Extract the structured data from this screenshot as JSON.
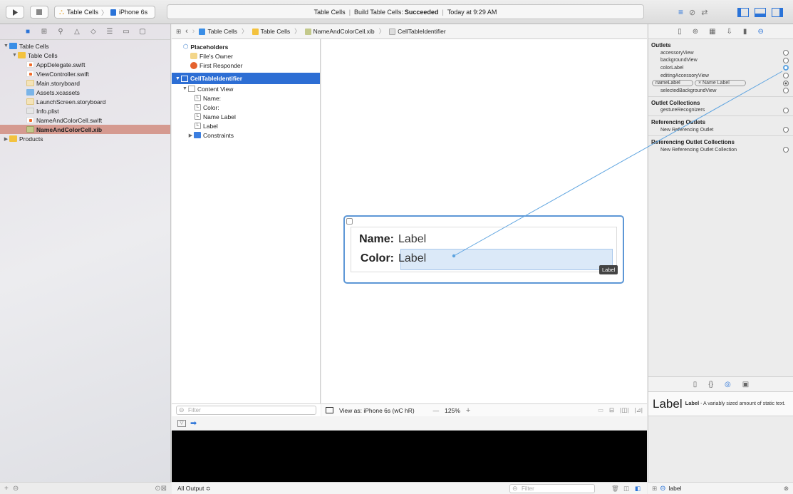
{
  "toolbar": {
    "run_icon": "play-icon",
    "stop_icon": "stop-icon",
    "scheme": {
      "app": "Table Cells",
      "device": "iPhone 6s"
    },
    "activity": {
      "project": "Table Cells",
      "build_prefix": "Build Table Cells:",
      "build_status": "Succeeded",
      "time": "Today at 9:29 AM"
    }
  },
  "navigator": {
    "tabs": [
      "folder-icon",
      "symbol-icon",
      "search-icon",
      "warning-icon",
      "test-icon",
      "debug-icon",
      "breakpoint-icon",
      "report-icon"
    ],
    "items": [
      {
        "label": "Table Cells",
        "icon": "proj",
        "level": 0,
        "disclosure": "▼"
      },
      {
        "label": "Table Cells",
        "icon": "folder",
        "level": 1,
        "disclosure": "▼"
      },
      {
        "label": "AppDelegate.swift",
        "icon": "swift",
        "level": 2
      },
      {
        "label": "ViewController.swift",
        "icon": "swift",
        "level": 2
      },
      {
        "label": "Main.storyboard",
        "icon": "sb",
        "level": 2
      },
      {
        "label": "Assets.xcassets",
        "icon": "xcassets",
        "level": 2
      },
      {
        "label": "LaunchScreen.storyboard",
        "icon": "sb",
        "level": 2
      },
      {
        "label": "Info.plist",
        "icon": "plist",
        "level": 2
      },
      {
        "label": "NameAndColorCell.swift",
        "icon": "swift",
        "level": 2
      },
      {
        "label": "NameAndColorCell.xib",
        "icon": "xib",
        "level": 2,
        "selected": true
      },
      {
        "label": "Products",
        "icon": "folder",
        "level": 0,
        "disclosure": "▶"
      }
    ]
  },
  "jumpbar": {
    "crumbs": [
      "Table Cells",
      "Table Cells",
      "NameAndColorCell.xib",
      "CellTableIdentifier"
    ]
  },
  "outline": {
    "placeholders": "Placeholders",
    "files_owner": "File's Owner",
    "first_responder": "First Responder",
    "cell": "CellTableIdentifier",
    "content_view": "Content View",
    "labels": [
      "Name:",
      "Color:",
      "Name Label",
      "Label"
    ],
    "constraints": "Constraints",
    "filter_placeholder": "Filter"
  },
  "canvas": {
    "name_key": "Name:",
    "name_val": "Label",
    "color_key": "Color:",
    "color_val": "Label",
    "tag": "Label",
    "view_as": "View as: iPhone 6s (wC hR)",
    "zoom": "125%",
    "zoom_minus": "—",
    "zoom_plus": "+"
  },
  "debug": {
    "output": "All Output ≎",
    "filter_placeholder": "Filter"
  },
  "inspector": {
    "tabs": [
      "file-icon",
      "help-icon",
      "identity-icon",
      "attributes-icon",
      "size-icon",
      "connections-icon"
    ],
    "outlets_title": "Outlets",
    "outlets": [
      {
        "name": "accessoryView",
        "filled": false
      },
      {
        "name": "backgroundView",
        "filled": false
      },
      {
        "name": "colorLabel",
        "filled": false,
        "highlight": true
      },
      {
        "name": "editingAccessoryView",
        "filled": false
      },
      {
        "name": "nameLabel",
        "filled": true,
        "target": "Name Label"
      },
      {
        "name": "selectedBackgroundView",
        "filled": false
      }
    ],
    "collections_title": "Outlet Collections",
    "collections": [
      {
        "name": "gestureRecognizers"
      }
    ],
    "referencing_title": "Referencing Outlets",
    "referencing": [
      {
        "name": "New Referencing Outlet"
      }
    ],
    "ref_collections_title": "Referencing Outlet Collections",
    "ref_collections": [
      {
        "name": "New Referencing Outlet Collection"
      }
    ],
    "lib_tabs": [
      "file-template-icon",
      "code-snippet-icon",
      "object-library-icon",
      "media-library-icon"
    ],
    "library": {
      "big_label": "Label",
      "title": "Label",
      "desc": " - A variably sized amount of static text."
    },
    "search_value": "label"
  },
  "colors": {
    "selection_blue": "#2d6ed4",
    "nav_selection": "#d59a90",
    "connection_line": "#5ea4e0",
    "cell_border": "#5d97d6"
  }
}
